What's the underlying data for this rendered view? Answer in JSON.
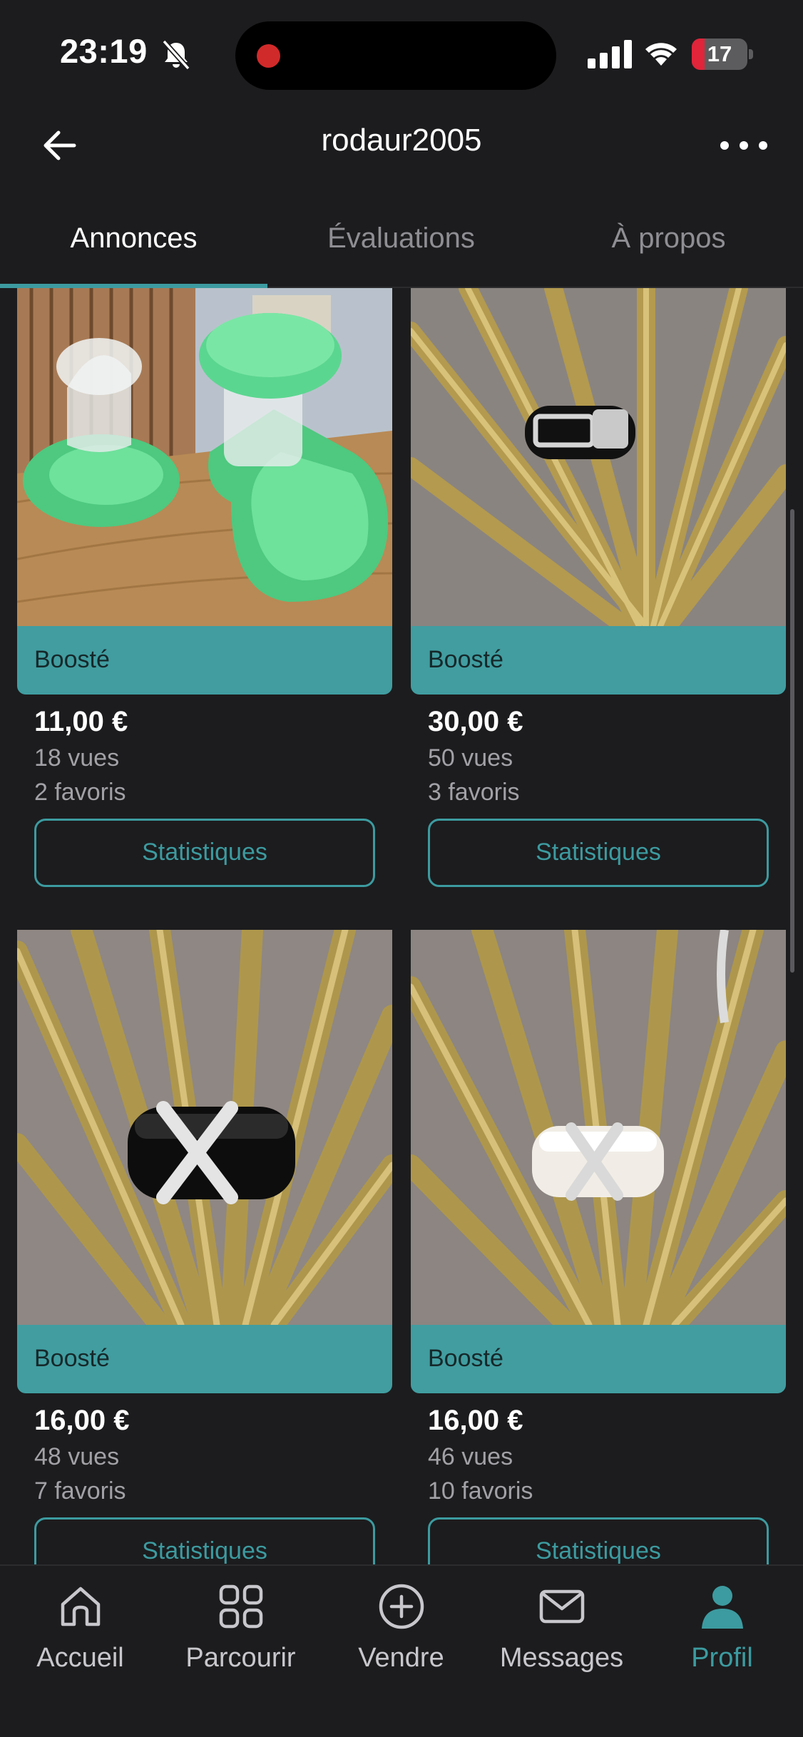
{
  "status_bar": {
    "time": "23:19",
    "battery_level": "17",
    "battery_fraction": 0.17,
    "accent_recording": "#d12a2a"
  },
  "header": {
    "title": "rodaur2005"
  },
  "tabs": [
    {
      "label": "Annonces",
      "active": true
    },
    {
      "label": "Évaluations",
      "active": false
    },
    {
      "label": "À propos",
      "active": false
    }
  ],
  "listings": [
    {
      "badge": "Boosté",
      "price": "11,00 €",
      "views": "18 vues",
      "favorites": "2 favoris",
      "button": "Statistiques",
      "image": "green-pet-water-feeders"
    },
    {
      "badge": "Boosté",
      "price": "30,00 €",
      "views": "50 vues",
      "favorites": "3 favoris",
      "button": "Statistiques",
      "image": "black-ring-with-buckle-on-gold-leaf"
    },
    {
      "badge": "Boosté",
      "price": "16,00 €",
      "views": "48 vues",
      "favorites": "7 favoris",
      "button": "Statistiques",
      "image": "black-ring-with-crystal-x-on-gold-leaf"
    },
    {
      "badge": "Boosté",
      "price": "16,00 €",
      "views": "46 vues",
      "favorites": "10 favoris",
      "button": "Statistiques",
      "image": "white-ring-with-crystal-x-on-gold-leaf"
    }
  ],
  "bottom_nav": [
    {
      "label": "Accueil",
      "icon": "home-icon",
      "active": false
    },
    {
      "label": "Parcourir",
      "icon": "grid-icon",
      "active": false
    },
    {
      "label": "Vendre",
      "icon": "plus-circle-icon",
      "active": false
    },
    {
      "label": "Messages",
      "icon": "mail-icon",
      "active": false
    },
    {
      "label": "Profil",
      "icon": "person-icon",
      "active": true
    }
  ],
  "colors": {
    "background": "#1c1c1e",
    "accent": "#3c9ba0",
    "boost_banner": "#419da0",
    "muted_text": "#a1a1a6"
  }
}
